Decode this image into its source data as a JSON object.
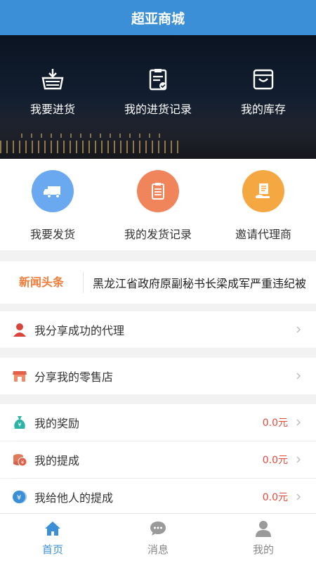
{
  "header": {
    "title": "超亚商城"
  },
  "hero": {
    "items": [
      {
        "label": "我要进货",
        "icon": "basket-download-icon"
      },
      {
        "label": "我的进货记录",
        "icon": "clipboard-check-icon"
      },
      {
        "label": "我的库存",
        "icon": "inventory-box-icon"
      }
    ]
  },
  "quick": {
    "items": [
      {
        "label": "我要发货",
        "icon": "truck-icon",
        "color": "#6aa8f0"
      },
      {
        "label": "我的发货记录",
        "icon": "clipboard-list-icon",
        "color": "#f0845a"
      },
      {
        "label": "邀请代理商",
        "icon": "hand-document-icon",
        "color": "#f5a742"
      }
    ]
  },
  "news": {
    "tag": "新闻头条",
    "headline": "黑龙江省政府原副秘书长梁成军严重违纪被"
  },
  "menu": {
    "shared_agents": "我分享成功的代理",
    "share_store": "分享我的零售店",
    "reward": {
      "label": "我的奖励",
      "value": "0.0元"
    },
    "commission": {
      "label": "我的提成",
      "value": "0.0元"
    },
    "others_commission": {
      "label": "我给他人的提成",
      "value": "0.0元"
    }
  },
  "tabs": [
    {
      "label": "首页",
      "icon": "home-icon",
      "active": true
    },
    {
      "label": "消息",
      "icon": "chat-bubble-icon",
      "active": false
    },
    {
      "label": "我的",
      "icon": "user-icon",
      "active": false
    }
  ],
  "colors": {
    "primary": "#3b8fd6",
    "accent": "#f07c3a",
    "money": "#e24a3b"
  }
}
